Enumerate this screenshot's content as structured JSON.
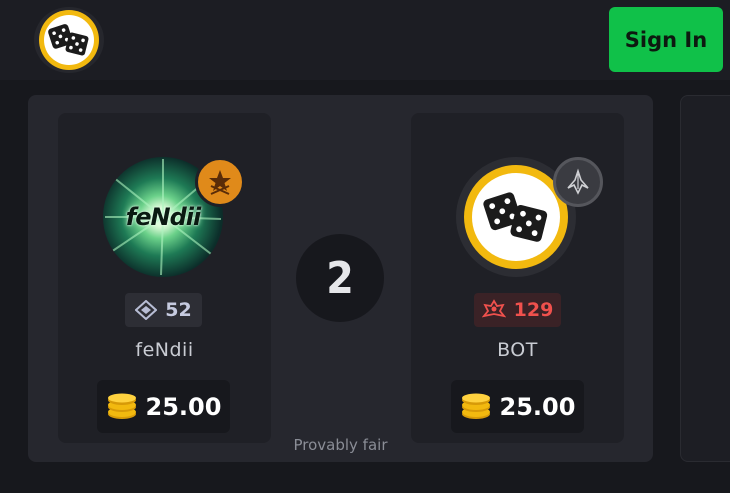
{
  "header": {
    "logo_icon": "dice-logo-icon",
    "signin_label": "Sign In"
  },
  "battle": {
    "round_number": "2",
    "provably_fair": "Provably fair",
    "players": [
      {
        "name": "feNdii",
        "avatar_text": "feNdii",
        "level": "52",
        "level_icon": "level-diamond-icon",
        "balance": "25.00",
        "rank_icon": "gold-star-rank-icon"
      },
      {
        "name": "BOT",
        "level": "129",
        "level_icon": "level-red-crest-icon",
        "balance": "25.00",
        "rank_icon": "grey-rank-icon"
      }
    ]
  },
  "colors": {
    "accent_green": "#10c149",
    "gold": "#f2b90f",
    "level_red": "#f0514d"
  }
}
